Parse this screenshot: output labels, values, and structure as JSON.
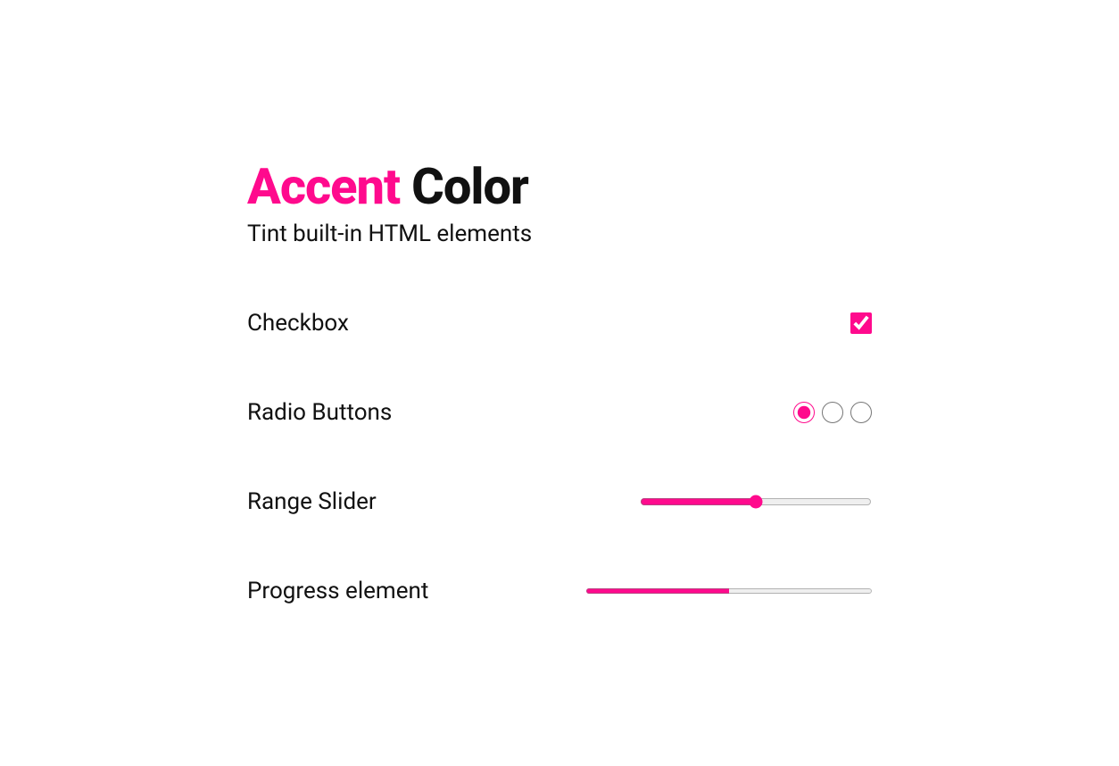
{
  "accent_color": "#ff0a8d",
  "title": {
    "accent": "Accent",
    "rest": " Color"
  },
  "subtitle": "Tint built-in HTML elements",
  "rows": {
    "checkbox": {
      "label": "Checkbox",
      "checked": true
    },
    "radio": {
      "label": "Radio Buttons",
      "options": [
        {
          "checked": true
        },
        {
          "checked": false
        },
        {
          "checked": false
        }
      ]
    },
    "range": {
      "label": "Range Slider",
      "value": 50,
      "min": 0,
      "max": 100
    },
    "progress": {
      "label": "Progress element",
      "value": 50,
      "max": 100
    }
  }
}
